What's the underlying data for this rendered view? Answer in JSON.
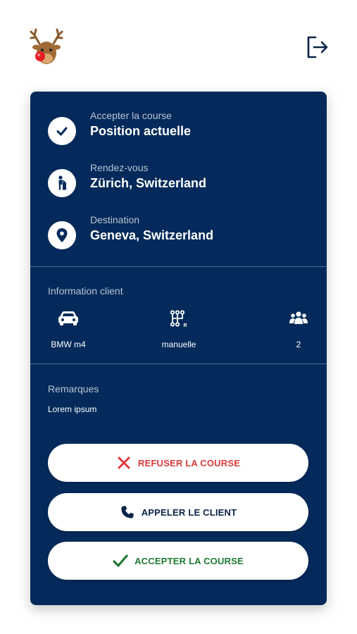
{
  "header": {
    "logo_icon": "reindeer-logo-icon",
    "logout_icon": "logout-icon"
  },
  "route": [
    {
      "label": "Accepter la course",
      "value": "Position actuelle",
      "icon": "check-icon"
    },
    {
      "label": "Rendez-vous",
      "value": "Zürich, Switzerland",
      "icon": "person-waiting-icon"
    },
    {
      "label": "Destination",
      "value": "Geneva, Switzerland",
      "icon": "map-pin-icon"
    }
  ],
  "client_info": {
    "title": "Information client",
    "items": [
      {
        "icon": "car-icon",
        "value": "BMW m4"
      },
      {
        "icon": "gearshift-icon",
        "value": "manuelle"
      },
      {
        "icon": "passengers-icon",
        "value": "2"
      }
    ]
  },
  "remarks": {
    "title": "Remarques",
    "text": "Lorem ipsum"
  },
  "actions": {
    "refuse": {
      "label": "REFUSER LA COURSE",
      "color": "#e03a3a",
      "icon": "close-icon"
    },
    "call": {
      "label": "APPELER LE CLIENT",
      "color": "#0b2348",
      "icon": "phone-icon"
    },
    "accept": {
      "label": "ACCEPTER LA COURSE",
      "color": "#1e7a32",
      "icon": "check-icon"
    }
  },
  "colors": {
    "card_bg": "#032a5a",
    "muted_text": "#b9c4d6",
    "divider": "#4d6b8f"
  }
}
